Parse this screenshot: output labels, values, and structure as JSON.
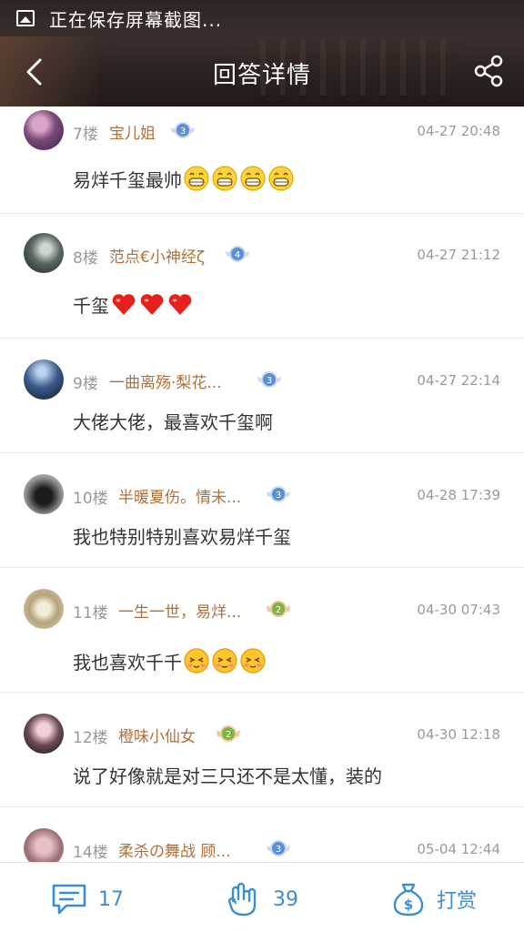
{
  "status_bar": {
    "text": "正在保存屏幕截图..."
  },
  "header": {
    "title": "回答详情"
  },
  "replies": [
    {
      "floor": "7楼",
      "user": "宝儿姐",
      "level": "3",
      "time": "04-27 20:48",
      "text": "易烊千玺最帅",
      "emoji": "grin",
      "emoji_count": 4
    },
    {
      "floor": "8楼",
      "user": "范点€小神经ζ",
      "level": "4",
      "time": "04-27 21:12",
      "text": "千玺",
      "emoji": "heart",
      "emoji_count": 3
    },
    {
      "floor": "9楼",
      "user": "一曲离殇·梨花...",
      "level": "3",
      "time": "04-27 22:14",
      "text": "大佬大佬，最喜欢千玺啊",
      "emoji": "",
      "emoji_count": 0
    },
    {
      "floor": "10楼",
      "user": "半暖夏伤。情未...",
      "level": "3",
      "time": "04-28 17:39",
      "text": "我也特别特别喜欢易烊千玺",
      "emoji": "",
      "emoji_count": 0
    },
    {
      "floor": "11楼",
      "user": "一生一世，易烊...",
      "level": "2",
      "time": "04-30 07:43",
      "text": "我也喜欢千千",
      "emoji": "shy",
      "emoji_count": 3
    },
    {
      "floor": "12楼",
      "user": "橙味小仙女",
      "level": "2",
      "time": "04-30 12:18",
      "text": "说了好像就是对三只还不是太懂，装的",
      "emoji": "",
      "emoji_count": 0
    },
    {
      "floor": "14楼",
      "user": "柔杀の舞战 顾...",
      "level": "3",
      "time": "05-04 12:44",
      "text": "",
      "emoji": "",
      "emoji_count": 0
    }
  ],
  "bottom_bar": {
    "comments": "17",
    "likes": "39",
    "reward": "打赏"
  },
  "colors": {
    "accent": "#3b8ed6",
    "username": "#b0703a",
    "level_blue": "#5b8fd8",
    "level_green": "#7cb342"
  }
}
